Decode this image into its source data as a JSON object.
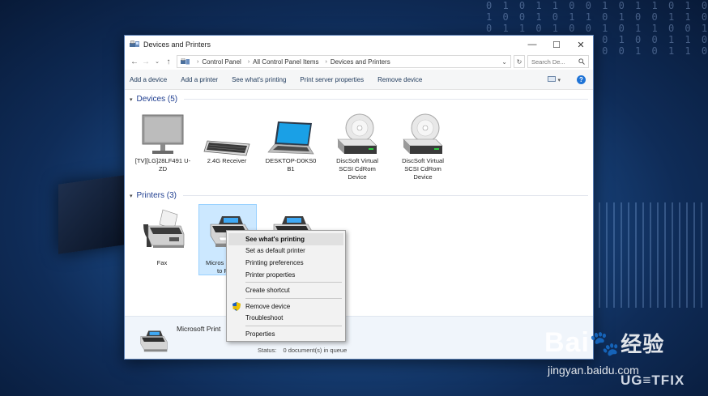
{
  "window": {
    "title": "Devices and Printers",
    "controls": {
      "minimize": "—",
      "maximize": "☐",
      "close": "✕"
    }
  },
  "address": {
    "breadcrumbs": [
      "Control Panel",
      "All Control Panel Items",
      "Devices and Printers"
    ],
    "search_placeholder": "Search De..."
  },
  "toolbar": {
    "items": [
      "Add a device",
      "Add a printer",
      "See what's printing",
      "Print server properties",
      "Remove device"
    ],
    "help": "?"
  },
  "devices": {
    "header": "Devices (5)",
    "items": [
      {
        "label": "[TV][LG]28LF491 U-ZD",
        "icon": "monitor-icon"
      },
      {
        "label": "2.4G Receiver",
        "icon": "keyboard-icon"
      },
      {
        "label": "DESKTOP-D0KS0 B1",
        "icon": "laptop-icon"
      },
      {
        "label": "DiscSoft Virtual SCSI CdRom Device",
        "icon": "cdrom-drive-icon"
      },
      {
        "label": "DiscSoft Virtual SCSI CdRom Device",
        "icon": "cdrom-drive-icon"
      }
    ]
  },
  "printers": {
    "header": "Printers (3)",
    "items": [
      {
        "label": "Fax",
        "icon": "fax-icon"
      },
      {
        "label": "Microsoft Print to PDF",
        "visible_label_line1": "Micros",
        "visible_label_line2": "to P",
        "icon": "printer-icon"
      },
      {
        "label": "",
        "icon": "printer-icon"
      }
    ]
  },
  "statusbar": {
    "name": "Microsoft Print",
    "status_label": "Status:",
    "status_value": "0 document(s) in queue"
  },
  "context_menu": {
    "items": [
      {
        "label": "See what's printing",
        "highlighted": true
      },
      {
        "label": "Set as default printer"
      },
      {
        "label": "Printing preferences"
      },
      {
        "label": "Printer properties"
      },
      {
        "label": "Create shortcut"
      },
      {
        "label": "Remove device",
        "icon": "uac-shield-icon"
      },
      {
        "label": "Troubleshoot"
      },
      {
        "label": "Properties"
      }
    ]
  },
  "watermarks": {
    "baidu": "Bai",
    "baidu_suffix": "经验",
    "site": "jingyan.baidu.com",
    "brand": "UG≡TFIX"
  },
  "colors": {
    "accent": "#1e73d6",
    "section_header": "#1e3d8f",
    "selection": "#cce8ff"
  }
}
